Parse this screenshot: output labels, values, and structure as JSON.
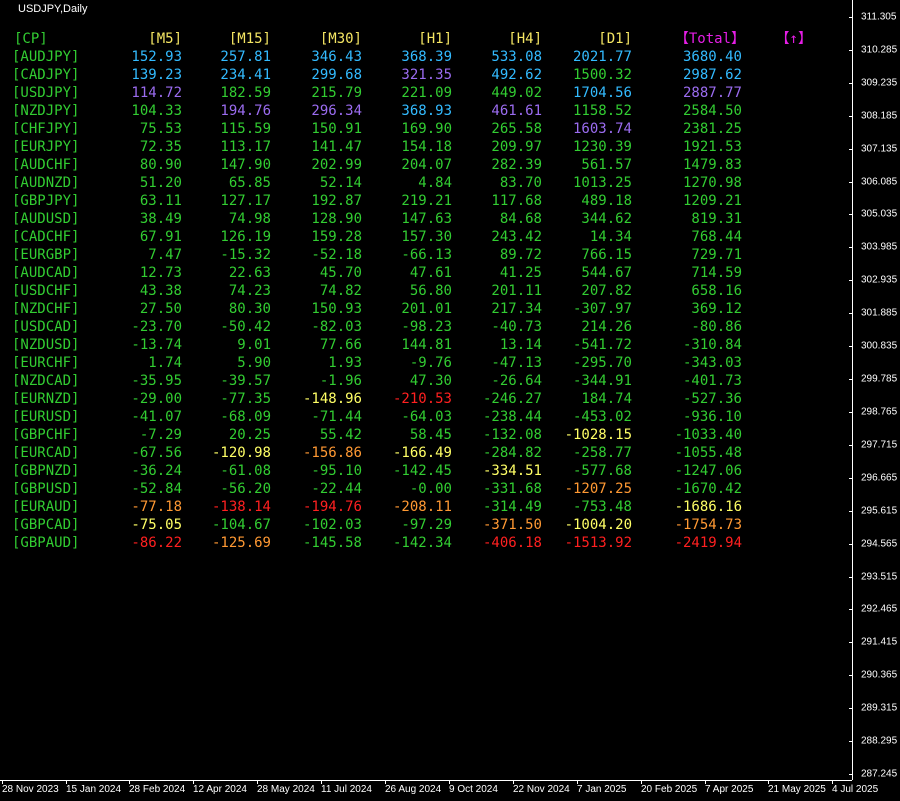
{
  "window": {
    "title": "USDJPY,Daily"
  },
  "colors": {
    "background": "#000000",
    "axis": "#ffffff",
    "header_yellow": "#f5e663",
    "header_magenta": "#e61ee6",
    "green": "#32cd32",
    "deepskyblue": "#33bbff",
    "purple": "#9b6cf0",
    "yellow": "#ffff66",
    "orange": "#ff9933",
    "red": "#ff2020",
    "white": "#ffffff"
  },
  "table": {
    "headers": [
      "[CP]",
      "[M5]",
      "[M15]",
      "[M30]",
      "[H1]",
      "[H4]",
      "[D1]",
      "【Total】",
      "【↑】"
    ],
    "rows": [
      {
        "pair": "[AUDJPY]",
        "v": [
          "152.93",
          "257.81",
          "346.43",
          "368.39",
          "533.08",
          "2021.77",
          "3680.40"
        ],
        "c": [
          "sky",
          "sky",
          "sky",
          "sky",
          "sky",
          "sky",
          "sky"
        ]
      },
      {
        "pair": "[CADJPY]",
        "v": [
          "139.23",
          "234.41",
          "299.68",
          "321.35",
          "492.62",
          "1500.32",
          "2987.62"
        ],
        "c": [
          "sky",
          "sky",
          "sky",
          "pur",
          "sky",
          "green",
          "sky"
        ]
      },
      {
        "pair": "[USDJPY]",
        "v": [
          "114.72",
          "182.59",
          "215.79",
          "221.09",
          "449.02",
          "1704.56",
          "2887.77"
        ],
        "c": [
          "pur",
          "green",
          "green",
          "green",
          "green",
          "sky",
          "pur"
        ]
      },
      {
        "pair": "[NZDJPY]",
        "v": [
          "104.33",
          "194.76",
          "296.34",
          "368.93",
          "461.61",
          "1158.52",
          "2584.50"
        ],
        "c": [
          "green",
          "pur",
          "pur",
          "sky",
          "pur",
          "green",
          "green"
        ]
      },
      {
        "pair": "[CHFJPY]",
        "v": [
          "75.53",
          "115.59",
          "150.91",
          "169.90",
          "265.58",
          "1603.74",
          "2381.25"
        ],
        "c": [
          "green",
          "green",
          "green",
          "green",
          "green",
          "pur",
          "green"
        ]
      },
      {
        "pair": "[EURJPY]",
        "v": [
          "72.35",
          "113.17",
          "141.47",
          "154.18",
          "209.97",
          "1230.39",
          "1921.53"
        ],
        "c": [
          "green",
          "green",
          "green",
          "green",
          "green",
          "green",
          "green"
        ]
      },
      {
        "pair": "[AUDCHF]",
        "v": [
          "80.90",
          "147.90",
          "202.99",
          "204.07",
          "282.39",
          "561.57",
          "1479.83"
        ],
        "c": [
          "green",
          "green",
          "green",
          "green",
          "green",
          "green",
          "green"
        ]
      },
      {
        "pair": "[AUDNZD]",
        "v": [
          "51.20",
          "65.85",
          "52.14",
          "4.84",
          "83.70",
          "1013.25",
          "1270.98"
        ],
        "c": [
          "green",
          "green",
          "green",
          "green",
          "green",
          "green",
          "green"
        ]
      },
      {
        "pair": "[GBPJPY]",
        "v": [
          "63.11",
          "127.17",
          "192.87",
          "219.21",
          "117.68",
          "489.18",
          "1209.21"
        ],
        "c": [
          "green",
          "green",
          "green",
          "green",
          "green",
          "green",
          "green"
        ]
      },
      {
        "pair": "[AUDUSD]",
        "v": [
          "38.49",
          "74.98",
          "128.90",
          "147.63",
          "84.68",
          "344.62",
          "819.31"
        ],
        "c": [
          "green",
          "green",
          "green",
          "green",
          "green",
          "green",
          "green"
        ]
      },
      {
        "pair": "[CADCHF]",
        "v": [
          "67.91",
          "126.19",
          "159.28",
          "157.30",
          "243.42",
          "14.34",
          "768.44"
        ],
        "c": [
          "green",
          "green",
          "green",
          "green",
          "green",
          "green",
          "green"
        ]
      },
      {
        "pair": "[EURGBP]",
        "v": [
          "7.47",
          "-15.32",
          "-52.18",
          "-66.13",
          "89.72",
          "766.15",
          "729.71"
        ],
        "c": [
          "green",
          "green",
          "green",
          "green",
          "green",
          "green",
          "green"
        ]
      },
      {
        "pair": "[AUDCAD]",
        "v": [
          "12.73",
          "22.63",
          "45.70",
          "47.61",
          "41.25",
          "544.67",
          "714.59"
        ],
        "c": [
          "green",
          "green",
          "green",
          "green",
          "green",
          "green",
          "green"
        ]
      },
      {
        "pair": "[USDCHF]",
        "v": [
          "43.38",
          "74.23",
          "74.82",
          "56.80",
          "201.11",
          "207.82",
          "658.16"
        ],
        "c": [
          "green",
          "green",
          "green",
          "green",
          "green",
          "green",
          "green"
        ]
      },
      {
        "pair": "[NZDCHF]",
        "v": [
          "27.50",
          "80.30",
          "150.93",
          "201.01",
          "217.34",
          "-307.97",
          "369.12"
        ],
        "c": [
          "green",
          "green",
          "green",
          "green",
          "green",
          "green",
          "green"
        ]
      },
      {
        "pair": "[USDCAD]",
        "v": [
          "-23.70",
          "-50.42",
          "-82.03",
          "-98.23",
          "-40.73",
          "214.26",
          "-80.86"
        ],
        "c": [
          "green",
          "green",
          "green",
          "green",
          "green",
          "green",
          "green"
        ]
      },
      {
        "pair": "[NZDUSD]",
        "v": [
          "-13.74",
          "9.01",
          "77.66",
          "144.81",
          "13.14",
          "-541.72",
          "-310.84"
        ],
        "c": [
          "green",
          "green",
          "green",
          "green",
          "green",
          "green",
          "green"
        ]
      },
      {
        "pair": "[EURCHF]",
        "v": [
          "1.74",
          "5.90",
          "1.93",
          "-9.76",
          "-47.13",
          "-295.70",
          "-343.03"
        ],
        "c": [
          "green",
          "green",
          "green",
          "green",
          "green",
          "green",
          "green"
        ]
      },
      {
        "pair": "[NZDCAD]",
        "v": [
          "-35.95",
          "-39.57",
          "-1.96",
          "47.30",
          "-26.64",
          "-344.91",
          "-401.73"
        ],
        "c": [
          "green",
          "green",
          "green",
          "green",
          "green",
          "green",
          "green"
        ]
      },
      {
        "pair": "[EURNZD]",
        "v": [
          "-29.00",
          "-77.35",
          "-148.96",
          "-210.53",
          "-246.27",
          "184.74",
          "-527.36"
        ],
        "c": [
          "green",
          "green",
          "yel",
          "red",
          "green",
          "green",
          "green"
        ]
      },
      {
        "pair": "[EURUSD]",
        "v": [
          "-41.07",
          "-68.09",
          "-71.44",
          "-64.03",
          "-238.44",
          "-453.02",
          "-936.10"
        ],
        "c": [
          "green",
          "green",
          "green",
          "green",
          "green",
          "green",
          "green"
        ]
      },
      {
        "pair": "[GBPCHF]",
        "v": [
          "-7.29",
          "20.25",
          "55.42",
          "58.45",
          "-132.08",
          "-1028.15",
          "-1033.40"
        ],
        "c": [
          "green",
          "green",
          "green",
          "green",
          "green",
          "yel",
          "green"
        ]
      },
      {
        "pair": "[EURCAD]",
        "v": [
          "-67.56",
          "-120.98",
          "-156.86",
          "-166.49",
          "-284.82",
          "-258.77",
          "-1055.48"
        ],
        "c": [
          "green",
          "yel",
          "ora",
          "yel",
          "green",
          "green",
          "green"
        ]
      },
      {
        "pair": "[GBPNZD]",
        "v": [
          "-36.24",
          "-61.08",
          "-95.10",
          "-142.45",
          "-334.51",
          "-577.68",
          "-1247.06"
        ],
        "c": [
          "green",
          "green",
          "green",
          "green",
          "yel",
          "green",
          "green"
        ]
      },
      {
        "pair": "[GBPUSD]",
        "v": [
          "-52.84",
          "-56.20",
          "-22.44",
          "-0.00",
          "-331.68",
          "-1207.25",
          "-1670.42"
        ],
        "c": [
          "green",
          "green",
          "green",
          "green",
          "green",
          "ora",
          "green"
        ]
      },
      {
        "pair": "[EURAUD]",
        "v": [
          "-77.18",
          "-138.14",
          "-194.76",
          "-208.11",
          "-314.49",
          "-753.48",
          "-1686.16"
        ],
        "c": [
          "ora",
          "red",
          "red",
          "ora",
          "green",
          "green",
          "yel"
        ]
      },
      {
        "pair": "[GBPCAD]",
        "v": [
          "-75.05",
          "-104.67",
          "-102.03",
          "-97.29",
          "-371.50",
          "-1004.20",
          "-1754.73"
        ],
        "c": [
          "yel",
          "green",
          "green",
          "green",
          "ora",
          "yel",
          "ora"
        ]
      },
      {
        "pair": "[GBPAUD]",
        "v": [
          "-86.22",
          "-125.69",
          "-145.58",
          "-142.34",
          "-406.18",
          "-1513.92",
          "-2419.94"
        ],
        "c": [
          "red",
          "ora",
          "green",
          "green",
          "red",
          "red",
          "red"
        ]
      }
    ]
  },
  "price_axis": {
    "labels": [
      "311.305",
      "310.285",
      "309.235",
      "308.185",
      "307.135",
      "306.085",
      "305.035",
      "303.985",
      "302.935",
      "301.885",
      "300.835",
      "299.785",
      "298.765",
      "297.715",
      "296.665",
      "295.615",
      "294.565",
      "293.515",
      "292.465",
      "291.415",
      "290.365",
      "289.315",
      "288.295",
      "287.245"
    ]
  },
  "time_axis": {
    "labels": [
      "28 Nov 2023",
      "15 Jan 2024",
      "28 Feb 2024",
      "12 Apr 2024",
      "28 May 2024",
      "11 Jul 2024",
      "26 Aug 2024",
      "9 Oct 2024",
      "22 Nov 2024",
      "7 Jan 2025",
      "20 Feb 2025",
      "7 Apr 2025",
      "21 May 2025",
      "4 Jul 2025"
    ]
  }
}
